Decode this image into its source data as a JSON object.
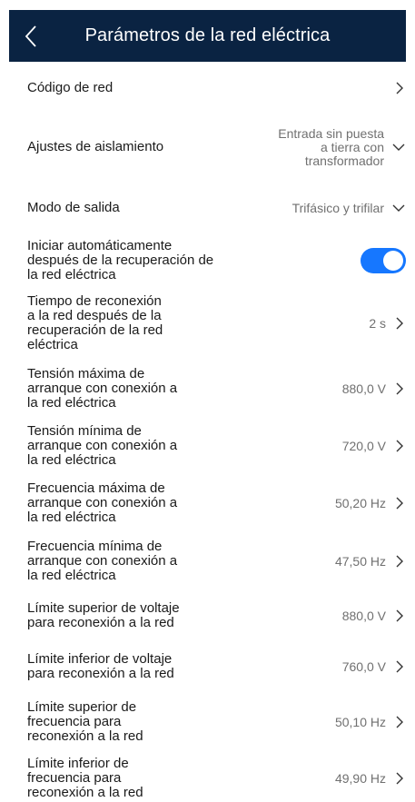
{
  "header": {
    "title": "Parámetros de la red eléctrica",
    "back_icon": "chevron-left-icon"
  },
  "colors": {
    "header_bg": "#0a2342",
    "toggle_on": "#1677ff",
    "value_text": "#707070"
  },
  "rows": [
    {
      "label": "Código de red",
      "value": "",
      "control": "chevron-right"
    },
    {
      "label": "Ajustes de aislamiento",
      "value_lines": [
        "Entrada sin puesta",
        "a tierra con",
        "transformador"
      ],
      "control": "chevron-down"
    },
    {
      "label": "Modo de salida",
      "value": "Trifásico y trifilar",
      "control": "chevron-down"
    },
    {
      "label_lines": [
        "Iniciar automáticamente",
        "después de la recuperación de",
        "la red eléctrica"
      ],
      "control": "toggle",
      "toggle_on": true
    },
    {
      "label_lines": [
        "Tiempo de reconexión",
        "a la red después de la",
        "recuperación de la red",
        "eléctrica"
      ],
      "value": "2 s",
      "control": "chevron-right"
    },
    {
      "label_lines": [
        "Tensión máxima de",
        "arranque con conexión a",
        "la red eléctrica"
      ],
      "value": "880,0 V",
      "control": "chevron-right"
    },
    {
      "label_lines": [
        "Tensión mínima de",
        "arranque con conexión a",
        "la red eléctrica"
      ],
      "value": "720,0 V",
      "control": "chevron-right"
    },
    {
      "label_lines": [
        "Frecuencia máxima de",
        "arranque con conexión a",
        "la red eléctrica"
      ],
      "value": "50,20 Hz",
      "control": "chevron-right"
    },
    {
      "label_lines": [
        "Frecuencia mínima de",
        "arranque con conexión a",
        "la red eléctrica"
      ],
      "value": "47,50 Hz",
      "control": "chevron-right"
    },
    {
      "label_lines": [
        "Límite superior de voltaje",
        "para reconexión a la red"
      ],
      "value": "880,0 V",
      "control": "chevron-right"
    },
    {
      "label_lines": [
        "Límite inferior de voltaje",
        "para reconexión a la red"
      ],
      "value": "760,0 V",
      "control": "chevron-right"
    },
    {
      "label_lines": [
        "Límite superior de",
        "frecuencia para",
        "reconexión a la red"
      ],
      "value": "50,10 Hz",
      "control": "chevron-right"
    },
    {
      "label_lines": [
        "Límite inferior de",
        "frecuencia para",
        "reconexión a la red"
      ],
      "value": "49,90 Hz",
      "control": "chevron-right"
    }
  ]
}
